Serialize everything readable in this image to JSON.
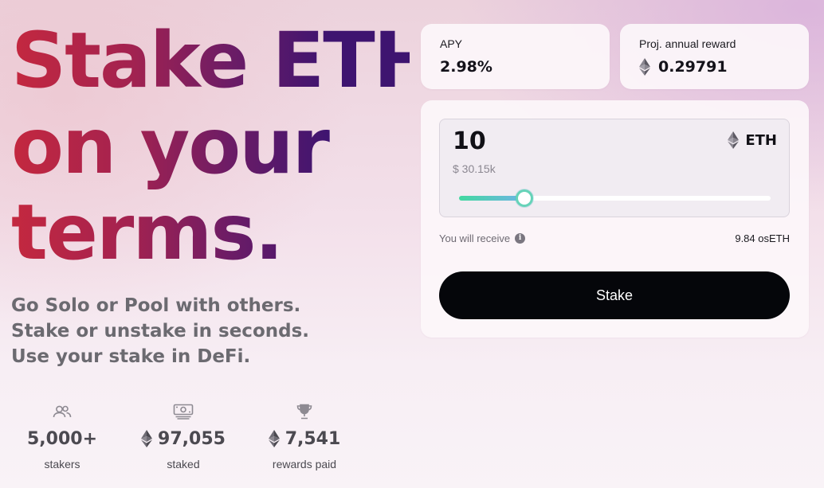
{
  "hero": {
    "title_lines": [
      "Stake ETH",
      "on your",
      "terms."
    ],
    "title_colors": [
      "#c4283f",
      "#a32250",
      "#6c1c66",
      "#3e1470"
    ],
    "taglines": [
      "Go Solo or Pool with others.",
      "Stake or unstake in seconds.",
      "Use your stake in DeFi."
    ]
  },
  "stats": [
    {
      "icon": "users-icon",
      "value": "5,000+",
      "label": "stakers"
    },
    {
      "icon": "banknote-icon",
      "value": "97,055",
      "label": "staked",
      "value_icon": "eth-icon"
    },
    {
      "icon": "trophy-icon",
      "value": "7,541",
      "label": "rewards paid",
      "value_icon": "eth-icon"
    }
  ],
  "metrics": {
    "apy": {
      "label": "APY",
      "value": "2.98%"
    },
    "annual_reward": {
      "label": "Proj. annual reward",
      "value": "0.29791",
      "icon": "eth-icon"
    }
  },
  "stake_form": {
    "amount": "10",
    "token": "ETH",
    "fiat_value": "$ 30.15k",
    "slider_fraction": 0.21,
    "receive_label": "You will receive",
    "receive_value": "9.84 osETH",
    "button_label": "Stake"
  },
  "colors": {
    "button_bg": "#05060a",
    "slider_gradient_start": "#43d8a0",
    "slider_gradient_end": "#6fb4e6",
    "tagline_text": "#6b6a70"
  }
}
